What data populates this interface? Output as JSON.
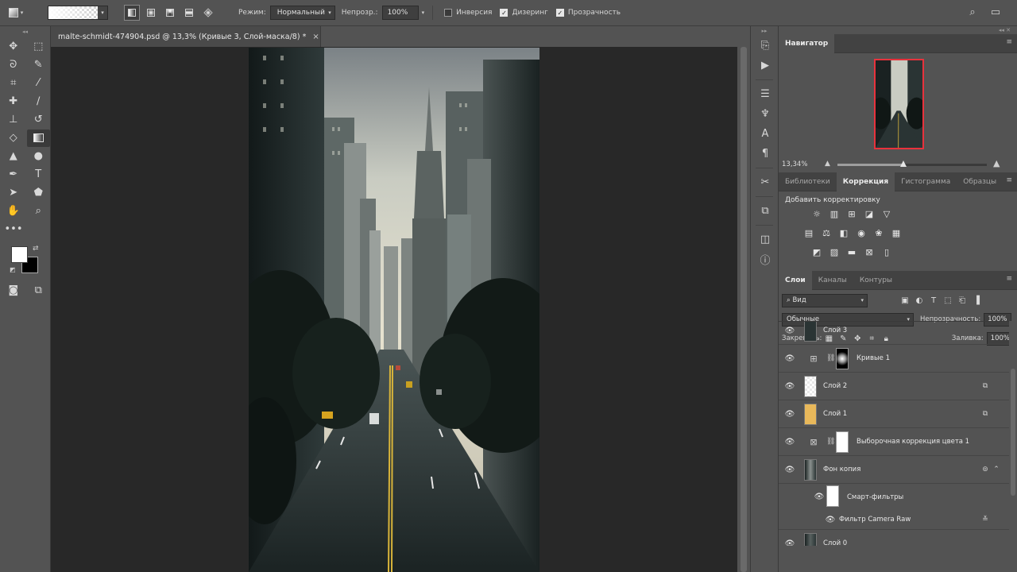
{
  "options_bar": {
    "mode_label": "Режим:",
    "mode_value": "Нормальный",
    "opacity_label": "Непрозр.:",
    "opacity_value": "100%",
    "inverse_label": "Инверсия",
    "inverse_checked": false,
    "dither_label": "Дизеринг",
    "dither_checked": true,
    "transparency_label": "Прозрачность",
    "transparency_checked": true
  },
  "document": {
    "tab_title": "malte-schmidt-474904.psd @ 13,3% (Кривые 3, Слой-маска/8) *",
    "close_glyph": "×"
  },
  "tools": [
    [
      "move-icon",
      "marquee-icon"
    ],
    [
      "lasso-icon",
      "quick-select-icon"
    ],
    [
      "crop-icon",
      "eyedropper-icon"
    ],
    [
      "healing-brush-icon",
      "brush-icon"
    ],
    [
      "clone-stamp-icon",
      "history-brush-icon"
    ],
    [
      "eraser-icon",
      "gradient-icon"
    ],
    [
      "blur-icon",
      "dodge-icon"
    ],
    [
      "pen-icon",
      "type-icon"
    ],
    [
      "path-select-icon",
      "shape-icon"
    ],
    [
      "hand-icon",
      "zoom-icon"
    ]
  ],
  "colors": {
    "foreground": "#ffffff",
    "background": "#000000"
  },
  "navigator": {
    "tab_label": "Навигатор",
    "zoom_text": "13,34%",
    "zoom_level": 0.44,
    "thumb_border_color": "#e8323c"
  },
  "adjustments": {
    "tabs": [
      "Библиотеки",
      "Коррекция",
      "Гистограмма",
      "Образцы"
    ],
    "active_tab": 1,
    "add_label": "Добавить корректировку"
  },
  "layers": {
    "tabs": [
      "Слои",
      "Каналы",
      "Контуры"
    ],
    "active_tab": 0,
    "filter_value": "Вид",
    "blend_mode": "Обычные",
    "opacity_label": "Непрозрачность:",
    "opacity_value": "100%",
    "lock_label": "Закрепить:",
    "fill_label": "Заливка:",
    "fill_value": "100%",
    "items": [
      {
        "name": "Слой 3"
      },
      {
        "name": "Кривые 1"
      },
      {
        "name": "Слой 2"
      },
      {
        "name": "Слой 1"
      },
      {
        "name": "Выборочная коррекция цвета 1"
      },
      {
        "name": "Фон копия"
      },
      {
        "name": "Смарт-фильтры"
      },
      {
        "name": "Фильтр Camera Raw"
      },
      {
        "name": "Слой 0"
      }
    ]
  }
}
